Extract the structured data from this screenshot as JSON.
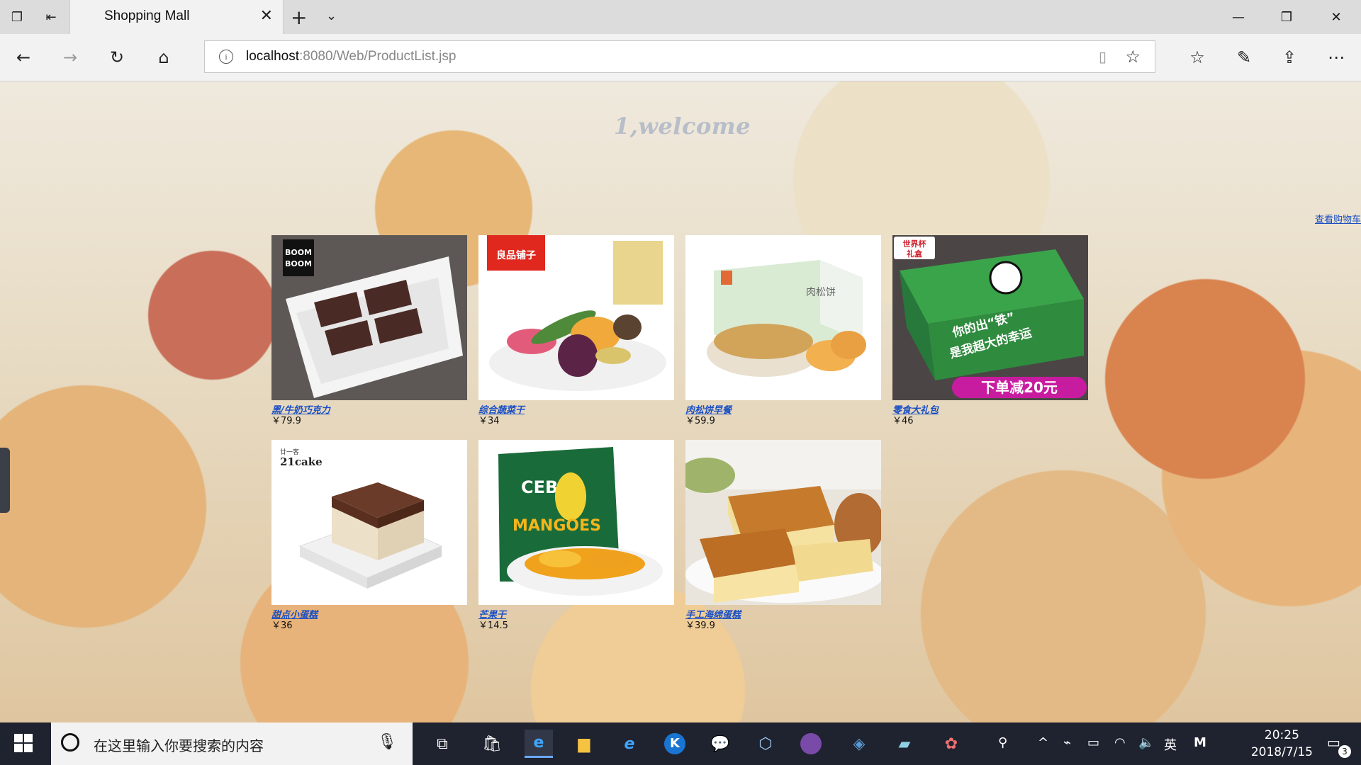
{
  "browser": {
    "tab_title": "Shopping Mall",
    "address_host": "localhost",
    "address_rest": ":8080/Web/ProductList.jsp",
    "icons": [
      "tab-set-aside-icon",
      "tab-preview-icon",
      "close-icon",
      "plus-icon",
      "chevron-down-icon",
      "minimize-icon",
      "restore-icon",
      "back-icon",
      "forward-icon",
      "refresh-icon",
      "home-icon",
      "info-icon",
      "reading-view-icon",
      "star-icon",
      "favorites-icon",
      "pen-icon",
      "share-icon",
      "more-icon"
    ]
  },
  "page": {
    "welcome": "1,welcome",
    "cart_link": "查看购物车",
    "products": [
      {
        "name": "黑/牛奶巧克力",
        "price": "￥79.9"
      },
      {
        "name": "综合蔬菜干",
        "price": "￥34"
      },
      {
        "name": "肉松饼早餐",
        "price": "￥59.9"
      },
      {
        "name": "零食大礼包",
        "price": "￥46"
      },
      {
        "name": "甜点小蛋糕",
        "price": "￥36"
      },
      {
        "name": "芒果干",
        "price": "￥14.5"
      },
      {
        "name": "手工海绵蛋糕",
        "price": "￥39.9"
      }
    ],
    "image_text": {
      "boom": "BOOM BOOM",
      "liangpin": "良品铺子",
      "rousong": "肉松饼",
      "gift_badge": "世界杯礼盒",
      "gift_slogan": "你的出“铁”是我超大的幸运",
      "gift_promo": "下单减20元",
      "cake_brand": "21cake",
      "cake_sub": "廿一客",
      "cebu": "CEBU",
      "mangoes": "MANGOES"
    }
  },
  "taskbar": {
    "search_placeholder": "在这里输入你要搜索的内容",
    "ime": "英",
    "time": "20:25",
    "date": "2018/7/15",
    "notification_count": "3",
    "apps": [
      "task-view-icon",
      "store-icon",
      "edge-icon",
      "file-explorer-icon",
      "ie-icon",
      "k-app-icon",
      "wechat-icon",
      "box-app-icon",
      "github-icon",
      "vs-app-icon",
      "tool-app-icon",
      "paint-app-icon"
    ]
  },
  "colors": {
    "link": "#1a4fc4",
    "welcome": "#b7bdc9",
    "taskbar": "#1f2330"
  }
}
